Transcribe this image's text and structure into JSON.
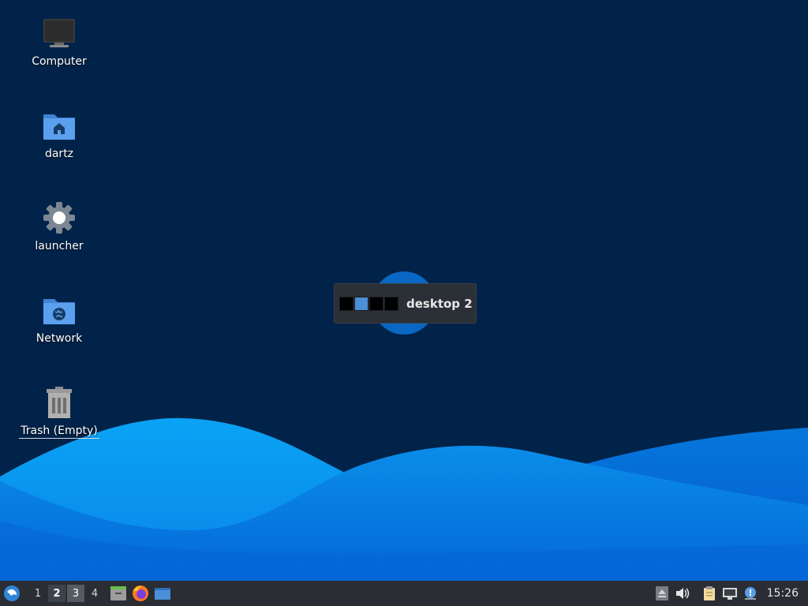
{
  "desktop": {
    "icons": [
      {
        "label": "Computer",
        "icon": "computer-icon"
      },
      {
        "label": "dartz",
        "icon": "home-folder-icon"
      },
      {
        "label": "launcher",
        "icon": "gear-icon"
      },
      {
        "label": "Network",
        "icon": "network-folder-icon"
      },
      {
        "label": "Trash (Empty)",
        "icon": "trash-icon"
      }
    ]
  },
  "workspace_popup": {
    "title": "desktop 2",
    "workspaces": 4,
    "active_workspace": 2
  },
  "taskbar": {
    "menu_icon": "xfce-whisker-menu-icon",
    "workspaces": [
      "1",
      "2",
      "3",
      "4"
    ],
    "current_workspace": "2",
    "launchers": [
      {
        "icon": "file-manager-icon"
      },
      {
        "icon": "firefox-icon"
      },
      {
        "icon": "show-desktop-icon"
      }
    ],
    "tray": {
      "icons": [
        "eject-icon",
        "volume-icon",
        "clipboard-icon",
        "network-wired-icon",
        "notification-icon"
      ],
      "clock": "15:26"
    }
  },
  "colors": {
    "desktop_bg": "#022349",
    "wave_light": "#0a9af0",
    "wave_dark": "#0469d6",
    "taskbar_bg": "#2a2d33",
    "accent": "#4b8fd9"
  }
}
